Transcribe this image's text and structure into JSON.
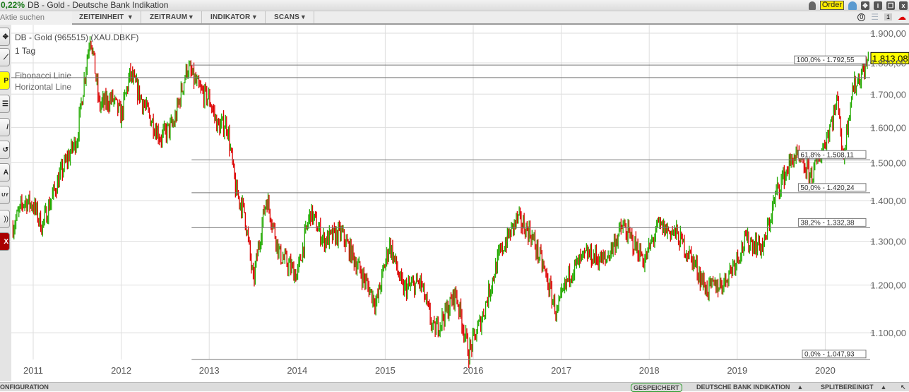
{
  "titlebar": {
    "change": "0,22%",
    "title": "DB - Gold - Deutsche Bank Indikation",
    "order_label": "Order",
    "icons": [
      "bell-icon",
      "cloud-icon",
      "move-icon",
      "info-icon",
      "restore-icon",
      "close-icon"
    ],
    "info_glyph": "i",
    "close_glyph": "x"
  },
  "toolbar": {
    "search_placeholder": "Aktie suchen",
    "menus": [
      {
        "label": "ZEITEINHEIT"
      },
      {
        "label": "ZEITRAUM"
      },
      {
        "label": "INDIKATOR"
      },
      {
        "label": "SCANS"
      }
    ],
    "arrow": "▼",
    "alert_count": "0",
    "tab_count": "1"
  },
  "tools": [
    {
      "name": "crosshair-tool",
      "glyph": "✥"
    },
    {
      "name": "line-tool",
      "glyph": "⟋"
    },
    {
      "name": "fibonacci-tool",
      "glyph": "P"
    },
    {
      "name": "fib-levels-tool",
      "glyph": "☰"
    },
    {
      "name": "trendline-tool",
      "glyph": "/"
    },
    {
      "name": "undo-tool",
      "glyph": "↺"
    },
    {
      "name": "text-tool",
      "glyph": "A"
    },
    {
      "name": "buy-sell-tool",
      "glyph": "UY"
    },
    {
      "name": "sound-tool",
      "glyph": "))"
    },
    {
      "name": "delete-tool",
      "glyph": "X"
    }
  ],
  "legend": {
    "instrument": "DB - Gold (965515) (XAU.DBKF)",
    "period": "1 Tag",
    "drawings": [
      "Fibonacci Linie",
      "Horizontal Line"
    ]
  },
  "chart_data": {
    "type": "candlestick",
    "scale": "log",
    "ylim": [
      1040,
      1905
    ],
    "y_ticks": [
      1100,
      1200,
      1300,
      1400,
      1500,
      1600,
      1700,
      1800,
      1900
    ],
    "y_tick_labels": [
      "1.100,00",
      "1.200,00",
      "1.300,00",
      "1.400,00",
      "1.500,00",
      "1.600,00",
      "1.700,00",
      "1.800,00",
      "1.900,00"
    ],
    "x_ticks": [
      2011,
      2012,
      2013,
      2014,
      2015,
      2016,
      2017,
      2018,
      2019,
      2020
    ],
    "x_tick_labels": [
      "2011",
      "2012",
      "2013",
      "2014",
      "2015",
      "2016",
      "2017",
      "2018",
      "2019",
      "2020"
    ],
    "xlim": [
      2010.77,
      2020.5
    ],
    "last_price": "1.813,08",
    "colors": {
      "up": "#22aa00",
      "down": "#dd0000",
      "last": "#ffff00"
    },
    "price_path": [
      [
        2010.77,
        1336
      ],
      [
        2010.9,
        1400
      ],
      [
        2011.0,
        1389
      ],
      [
        2011.1,
        1336
      ],
      [
        2011.3,
        1463
      ],
      [
        2011.5,
        1570
      ],
      [
        2011.65,
        1900
      ],
      [
        2011.75,
        1664
      ],
      [
        2011.9,
        1686
      ],
      [
        2012.0,
        1632
      ],
      [
        2012.1,
        1763
      ],
      [
        2012.3,
        1643
      ],
      [
        2012.45,
        1570
      ],
      [
        2012.6,
        1611
      ],
      [
        2012.75,
        1786
      ],
      [
        2012.9,
        1708
      ],
      [
        2013.0,
        1686
      ],
      [
        2013.1,
        1601
      ],
      [
        2013.2,
        1611
      ],
      [
        2013.3,
        1426
      ],
      [
        2013.4,
        1371
      ],
      [
        2013.5,
        1206
      ],
      [
        2013.65,
        1408
      ],
      [
        2013.8,
        1269
      ],
      [
        2014.0,
        1221
      ],
      [
        2014.15,
        1371
      ],
      [
        2014.3,
        1302
      ],
      [
        2014.5,
        1319
      ],
      [
        2014.7,
        1237
      ],
      [
        2014.9,
        1160
      ],
      [
        2015.05,
        1294
      ],
      [
        2015.2,
        1190
      ],
      [
        2015.4,
        1206
      ],
      [
        2015.55,
        1102
      ],
      [
        2015.7,
        1145
      ],
      [
        2015.8,
        1183
      ],
      [
        2015.95,
        1060
      ],
      [
        2016.1,
        1131
      ],
      [
        2016.3,
        1269
      ],
      [
        2016.5,
        1354
      ],
      [
        2016.65,
        1319
      ],
      [
        2016.8,
        1237
      ],
      [
        2016.95,
        1138
      ],
      [
        2017.1,
        1229
      ],
      [
        2017.3,
        1269
      ],
      [
        2017.5,
        1254
      ],
      [
        2017.7,
        1336
      ],
      [
        2017.95,
        1254
      ],
      [
        2018.1,
        1336
      ],
      [
        2018.3,
        1319
      ],
      [
        2018.5,
        1254
      ],
      [
        2018.65,
        1190
      ],
      [
        2018.85,
        1206
      ],
      [
        2019.1,
        1302
      ],
      [
        2019.3,
        1286
      ],
      [
        2019.45,
        1426
      ],
      [
        2019.65,
        1520
      ],
      [
        2019.85,
        1463
      ],
      [
        2020.0,
        1560
      ],
      [
        2020.15,
        1686
      ],
      [
        2020.2,
        1500
      ],
      [
        2020.3,
        1708
      ],
      [
        2020.5,
        1813
      ]
    ],
    "fibonacci": {
      "start": 2012.8,
      "levels": [
        {
          "price": 1792.55,
          "label": "100,0% - 1.792,55"
        },
        {
          "price": 1508.11,
          "label": "61,8% - 1.508,11"
        },
        {
          "price": 1420.24,
          "label": "50,0% - 1.420,24"
        },
        {
          "price": 1332.38,
          "label": "38,2% - 1.332,38"
        },
        {
          "price": 1047.93,
          "label": "0,0% - 1.047,93"
        }
      ]
    },
    "horizontal_line": 1752
  },
  "bottombar": {
    "left": "ONFIGURATION",
    "saved": "GESPEICHERT",
    "source": "DEUTSCHE BANK INDIKATION",
    "adjust": "SPLITBEREINIGT",
    "arrow": "▲",
    "expand": "↖"
  }
}
